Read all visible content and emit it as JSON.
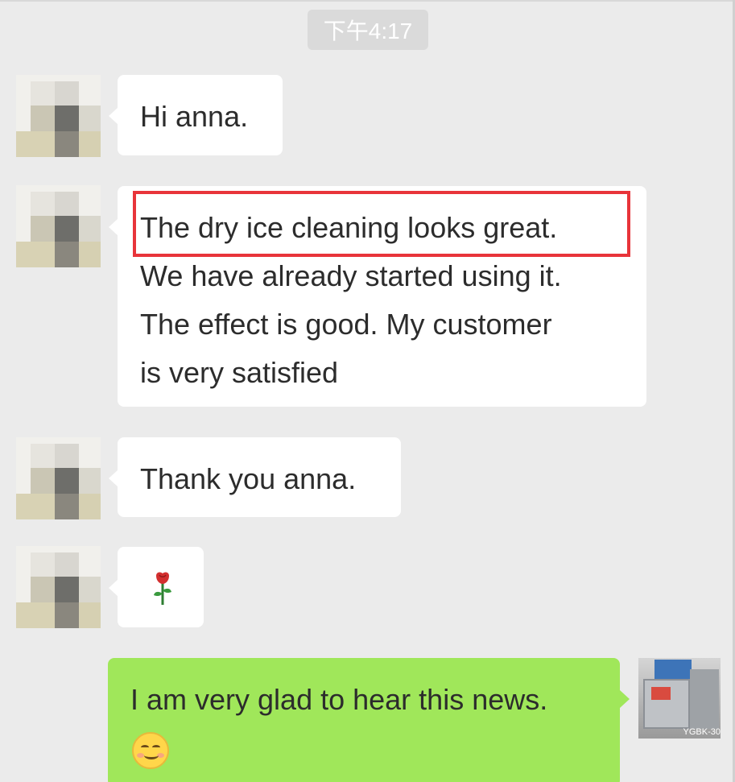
{
  "timestamp": "下午4:17",
  "messages": [
    {
      "sender": "other",
      "text": "Hi anna."
    },
    {
      "sender": "other",
      "lines": [
        "The dry ice cleaning looks great.",
        "We have already started using it.",
        "The effect is good. My customer",
        "is very satisfied"
      ]
    },
    {
      "sender": "other",
      "text": "Thank you anna."
    },
    {
      "sender": "other",
      "emoji": "rose-emoji"
    },
    {
      "sender": "me",
      "text": "I am very glad to hear this news.",
      "emoji": "smiling-face-emoji"
    }
  ],
  "my_avatar_caption": "YGBK-30",
  "colors": {
    "background": "#ebebeb",
    "incoming_bubble": "#ffffff",
    "outgoing_bubble": "#a0e75a",
    "highlight_box": "#e8343a",
    "timestamp_pill": "#dadada"
  }
}
